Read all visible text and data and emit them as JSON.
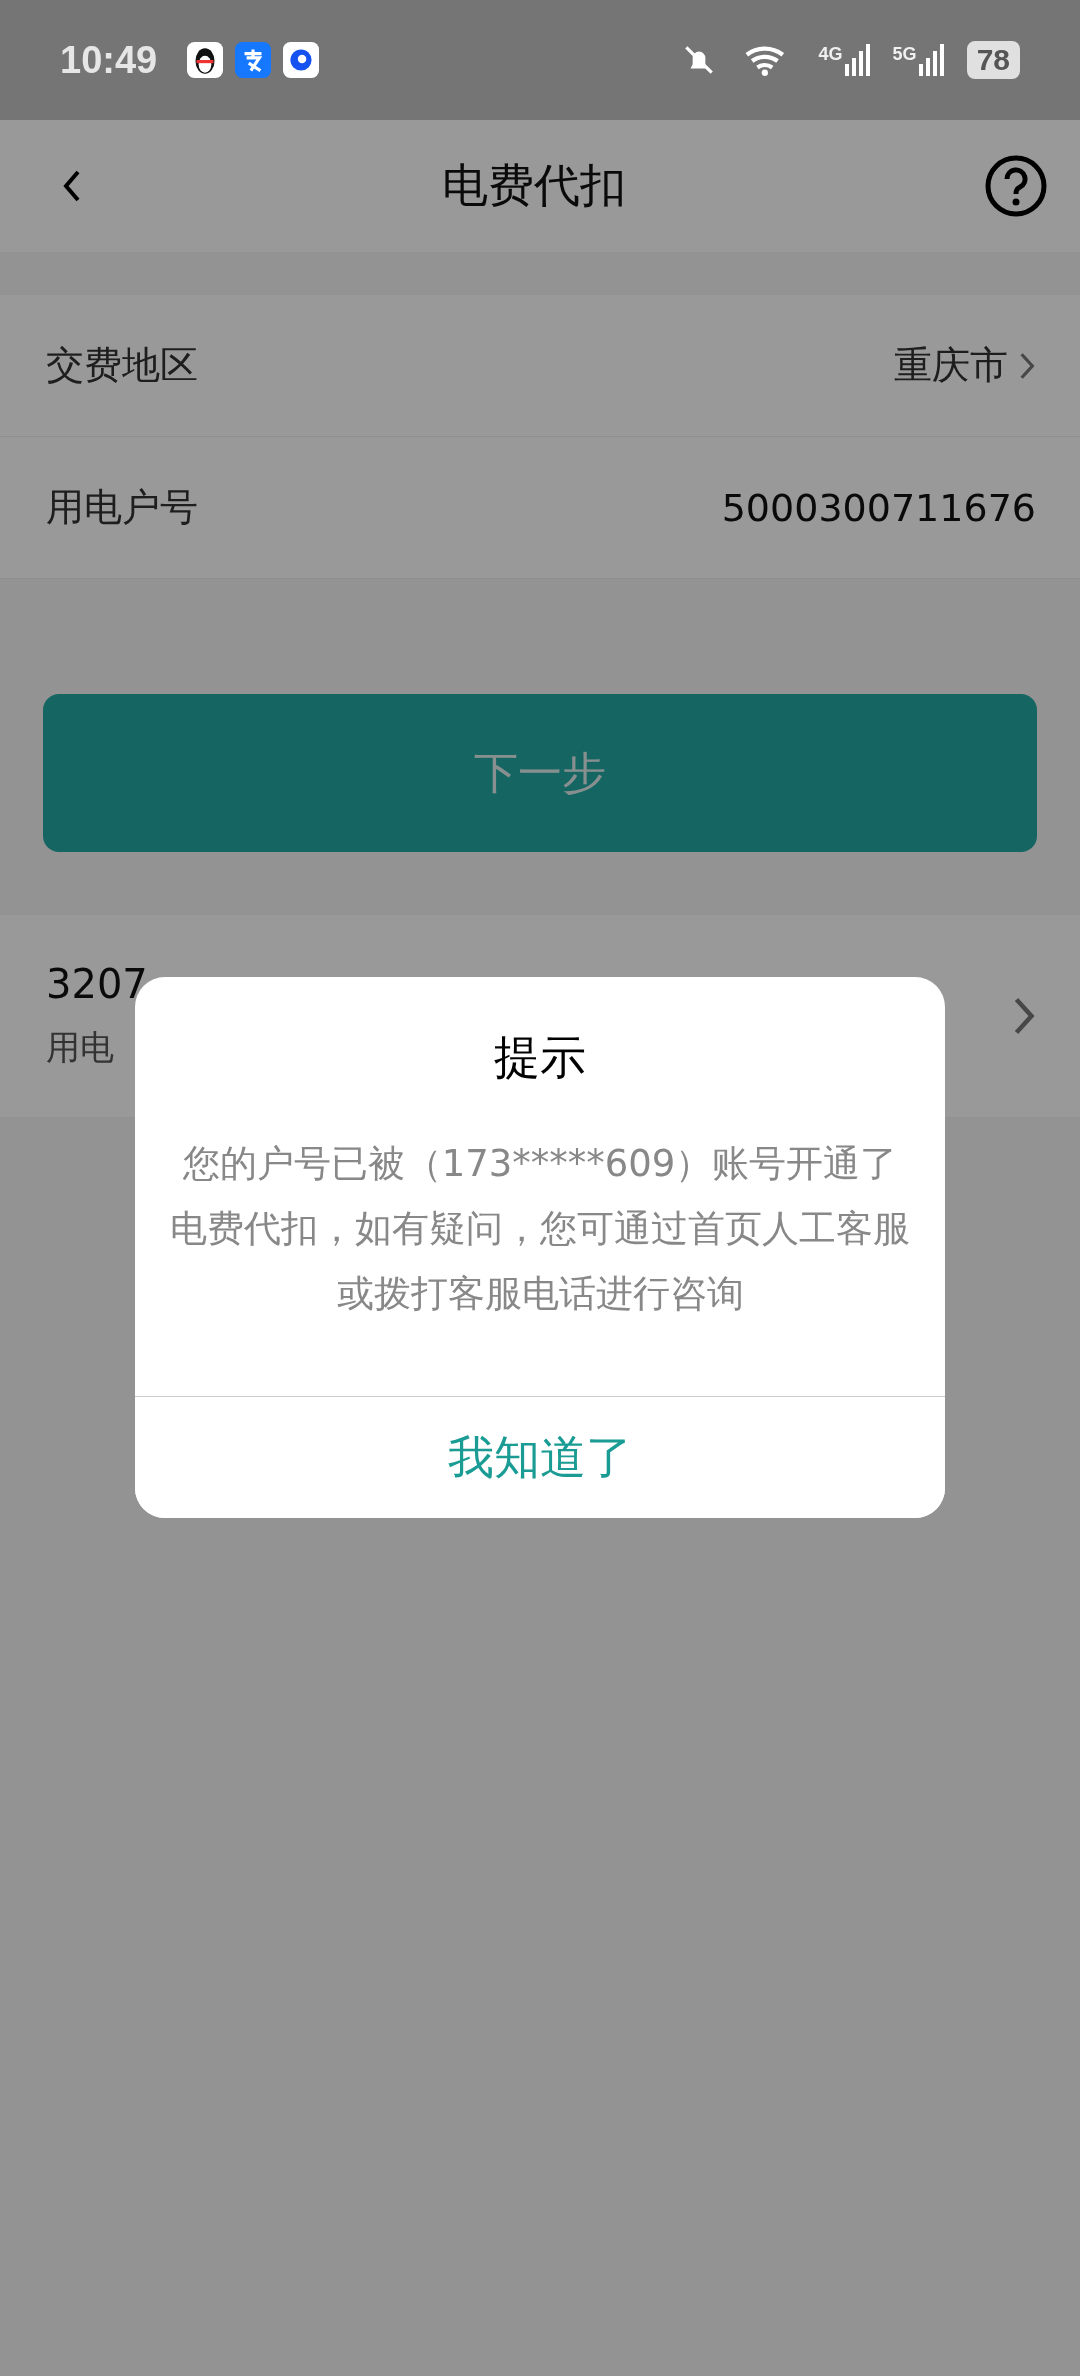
{
  "status_bar": {
    "time": "10:49",
    "signals": [
      {
        "label": "4G"
      },
      {
        "label": "5G"
      }
    ],
    "battery": "78"
  },
  "header": {
    "title": "电费代扣"
  },
  "form_rows": [
    {
      "label": "交费地区",
      "value": "重庆市",
      "kind": "select"
    },
    {
      "label": "用电户号",
      "value": "5000300711676",
      "kind": "text"
    }
  ],
  "next_button": {
    "label": "下一步"
  },
  "account_card": {
    "number": "3207",
    "address": "用电"
  },
  "dialog": {
    "title": "提示",
    "message": "您的户号已被（173*****609）账号开通了电费代扣，如有疑问，您可通过首页人工客服或拨打客服电话进行咨询",
    "confirm": "我知道了"
  }
}
